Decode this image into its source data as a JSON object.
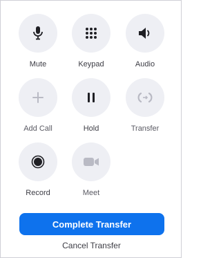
{
  "controls": [
    {
      "label": "Mute",
      "icon": "microphone-icon"
    },
    {
      "label": "Keypad",
      "icon": "keypad-icon"
    },
    {
      "label": "Audio",
      "icon": "speaker-icon"
    },
    {
      "label": "Add Call",
      "icon": "plus-icon",
      "state": "disabled"
    },
    {
      "label": "Hold",
      "icon": "pause-icon"
    },
    {
      "label": "Transfer",
      "icon": "transfer-icon",
      "state": "disabled"
    },
    {
      "label": "Record",
      "icon": "record-icon"
    },
    {
      "label": "Meet",
      "icon": "video-camera-icon",
      "state": "disabled"
    }
  ],
  "actions": {
    "complete_transfer": "Complete Transfer",
    "cancel_transfer": "Cancel Transfer"
  },
  "colors": {
    "accent": "#0e72ed",
    "button_bg": "#eeeff4",
    "icon_active": "#1f1f24",
    "icon_disabled": "#b9bac4"
  }
}
